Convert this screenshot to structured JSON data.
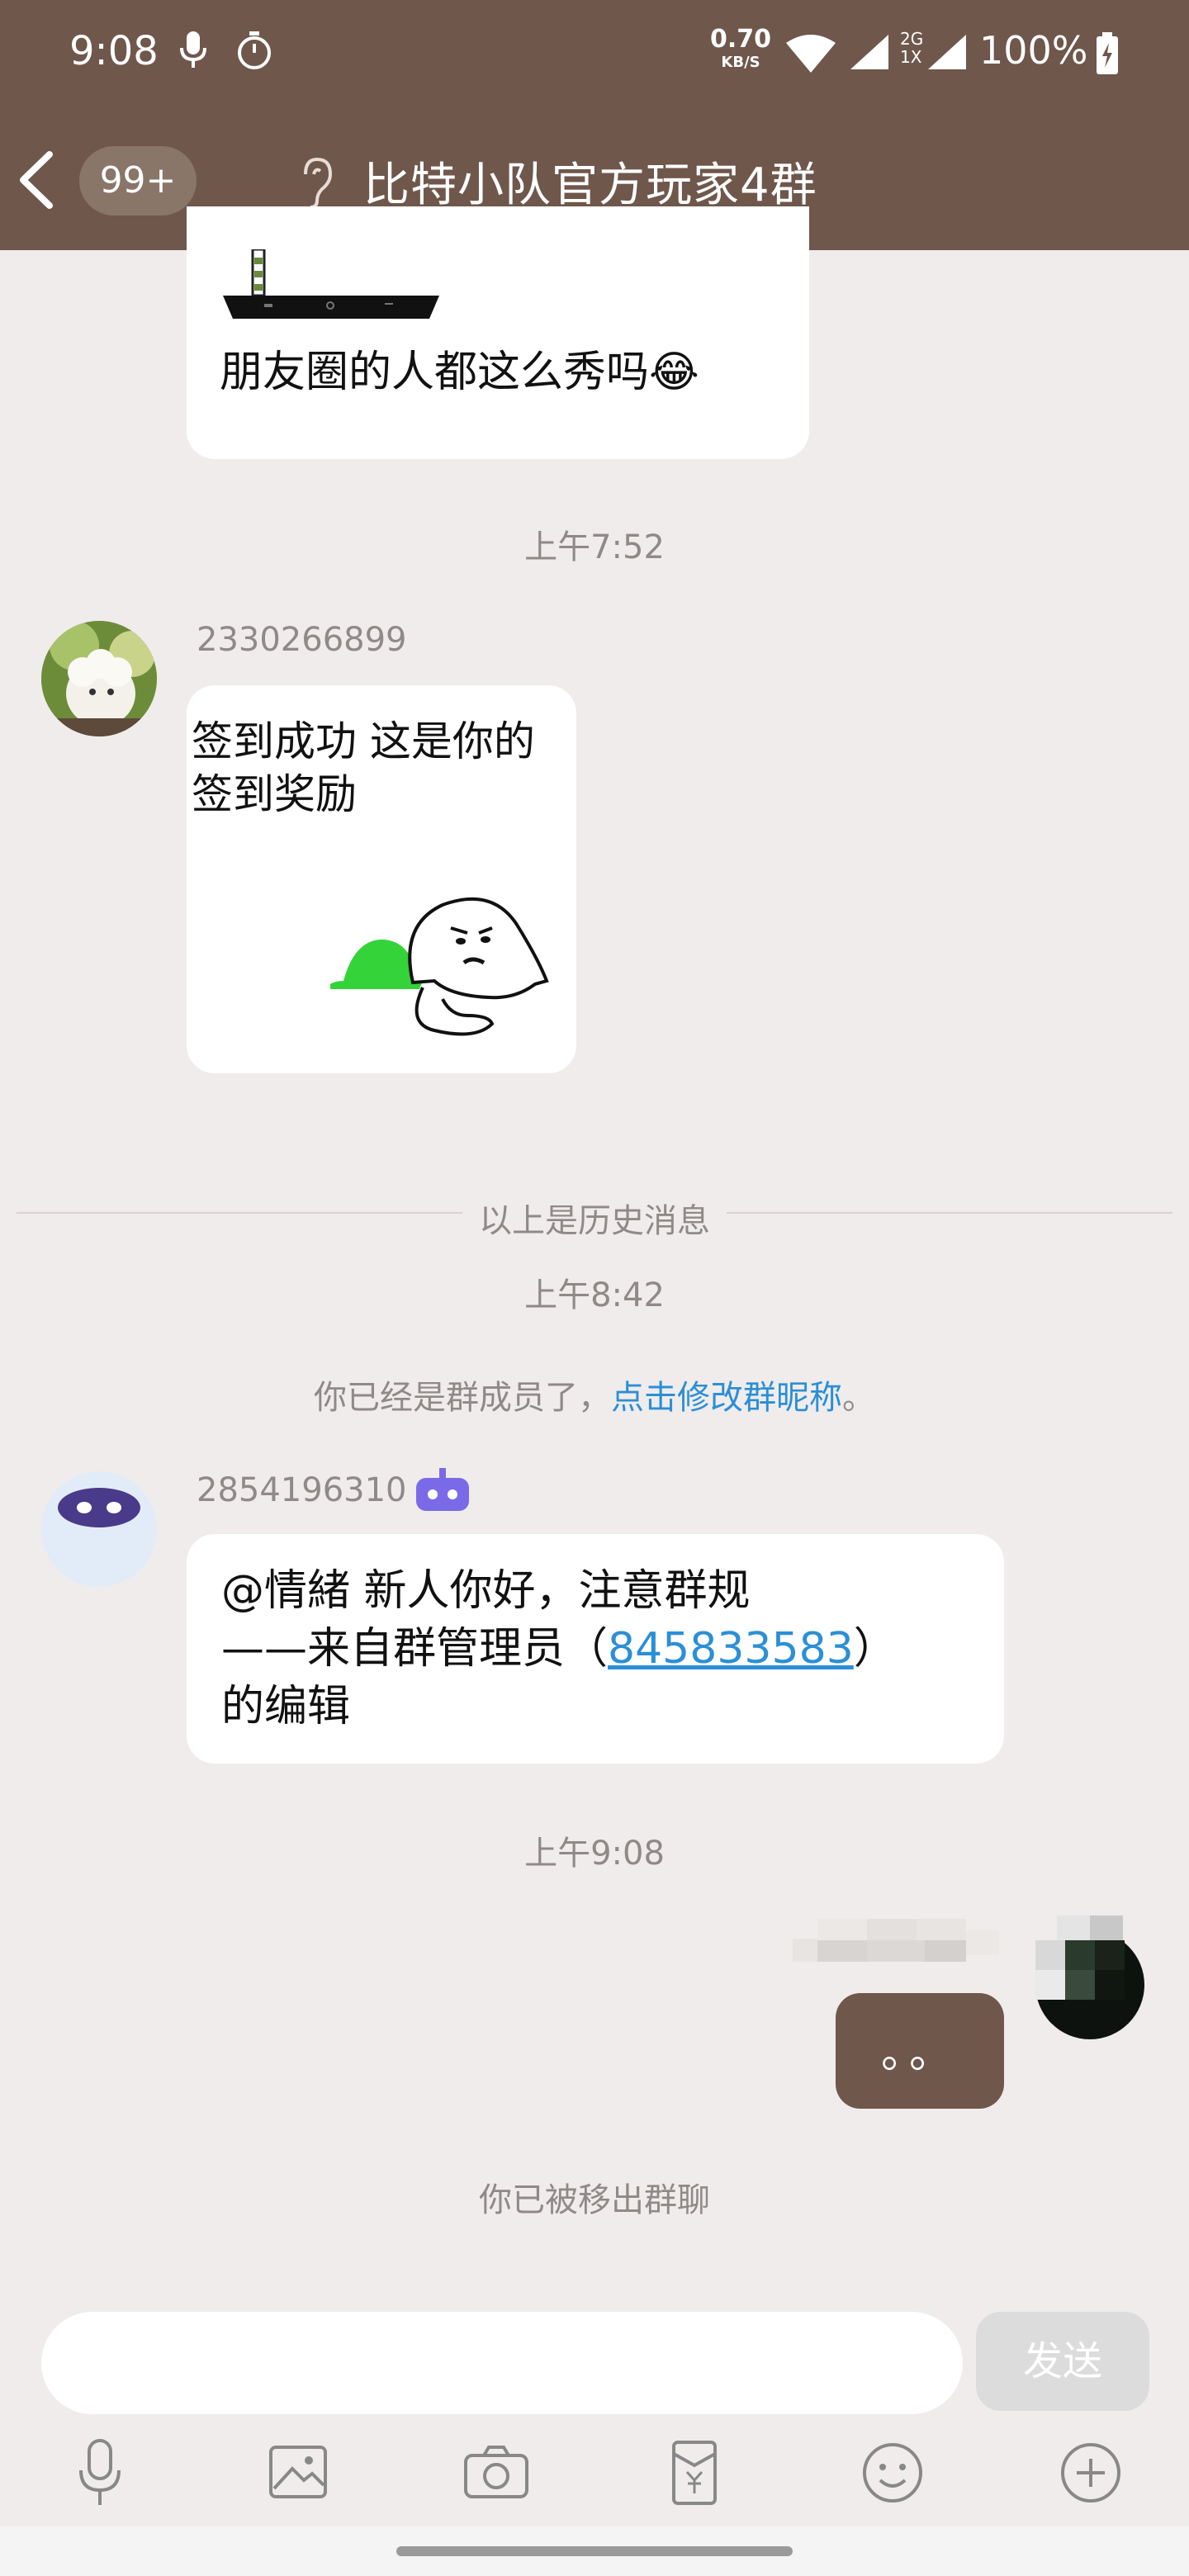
{
  "status_bar": {
    "time": "9:08",
    "net_rate": "0.70",
    "net_unit": "KB/S",
    "sim_label": "2G",
    "sim_label2": "1X",
    "battery": "100%"
  },
  "nav": {
    "unread_badge": "99+",
    "title": "比特小队官方玩家4群"
  },
  "messages": {
    "m1_text": "朋友圈的人都这么秀吗😂",
    "time1": "上午7:52",
    "m2_sender": "2330266899",
    "m2_sticker_text": "签到成功 这是你的\n签到奖励",
    "history_divider": "以上是历史消息",
    "time2": "上午8:42",
    "sys1_prefix": "你已经是群成员了，",
    "sys1_link": "点击修改群昵称",
    "sys1_suffix": "。",
    "m3_sender": "2854196310",
    "m3_line1": "@情緒 新人你好，注意群规",
    "m3_line2_prefix": "——来自群管理员（",
    "m3_line2_link": "845833583",
    "m3_line2_suffix": "）",
    "m3_line3": "的编辑",
    "time3": "上午9:08",
    "m4_text": "。。",
    "sys2": "你已被移出群聊"
  },
  "input": {
    "placeholder": "",
    "send_label": "发送"
  },
  "toolbar": {
    "items": [
      "microphone-icon",
      "image-icon",
      "camera-icon",
      "red-packet-icon",
      "emoji-icon",
      "plus-icon"
    ]
  },
  "colors": {
    "header": "#6f574c",
    "background": "#f0ecec",
    "link": "#2b8fd6",
    "my_bubble": "#6f574c"
  }
}
